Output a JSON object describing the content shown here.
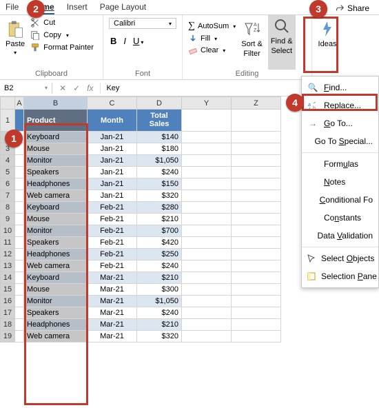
{
  "tabs": {
    "file": "File",
    "home": "Home",
    "insert": "Insert",
    "page_layout": "Page Layout"
  },
  "share": "Share",
  "clipboard": {
    "paste": "Paste",
    "cut": "Cut",
    "copy": "Copy",
    "format_painter": "Format Painter",
    "label": "Clipboard"
  },
  "font": {
    "name": "Calibri",
    "bold": "B",
    "italic": "I",
    "underline": "U",
    "label": "Font"
  },
  "editing": {
    "autosum": "AutoSum",
    "fill": "Fill",
    "clear": "Clear",
    "sort": "Sort &",
    "filter": "Filter",
    "find": "Find &",
    "select": "Select",
    "label": "Editing"
  },
  "ideas": "Ideas",
  "namebox": "B2",
  "fx": "fx",
  "formula_value": "Key",
  "col_headers": [
    "A",
    "B",
    "C",
    "D",
    "Y",
    "Z"
  ],
  "table": {
    "headers": {
      "product": "Product",
      "month": "Month",
      "sales": "Total Sales"
    },
    "rows": [
      {
        "n": 2,
        "p": "Keyboard",
        "m": "Jan-21",
        "s": "$140"
      },
      {
        "n": 3,
        "p": "Mouse",
        "m": "Jan-21",
        "s": "$180"
      },
      {
        "n": 4,
        "p": "Monitor",
        "m": "Jan-21",
        "s": "$1,050"
      },
      {
        "n": 5,
        "p": "Speakers",
        "m": "Jan-21",
        "s": "$240"
      },
      {
        "n": 6,
        "p": "Headphones",
        "m": "Jan-21",
        "s": "$150"
      },
      {
        "n": 7,
        "p": "Web camera",
        "m": "Jan-21",
        "s": "$320"
      },
      {
        "n": 8,
        "p": "Keyboard",
        "m": "Feb-21",
        "s": "$280"
      },
      {
        "n": 9,
        "p": "Mouse",
        "m": "Feb-21",
        "s": "$210"
      },
      {
        "n": 10,
        "p": "Monitor",
        "m": "Feb-21",
        "s": "$700"
      },
      {
        "n": 11,
        "p": "Speakers",
        "m": "Feb-21",
        "s": "$420"
      },
      {
        "n": 12,
        "p": "Headphones",
        "m": "Feb-21",
        "s": "$250"
      },
      {
        "n": 13,
        "p": "Web camera",
        "m": "Feb-21",
        "s": "$240"
      },
      {
        "n": 14,
        "p": "Keyboard",
        "m": "Mar-21",
        "s": "$210"
      },
      {
        "n": 15,
        "p": "Mouse",
        "m": "Mar-21",
        "s": "$300"
      },
      {
        "n": 16,
        "p": "Monitor",
        "m": "Mar-21",
        "s": "$1,050"
      },
      {
        "n": 17,
        "p": "Speakers",
        "m": "Mar-21",
        "s": "$240"
      },
      {
        "n": 18,
        "p": "Headphones",
        "m": "Mar-21",
        "s": "$210"
      },
      {
        "n": 19,
        "p": "Web camera",
        "m": "Mar-21",
        "s": "$320"
      }
    ]
  },
  "menu": {
    "find": "Find...",
    "replace": "Replace...",
    "goto": "Go To...",
    "gotospecial": "Go To Special...",
    "formulas": "Formulas",
    "notes": "Notes",
    "cond": "Conditional Fo",
    "constants": "Constants",
    "datav": "Data Validation",
    "selobj": "Select Objects",
    "selpane": "Selection Pane"
  },
  "callouts": {
    "c1": "1",
    "c2": "2",
    "c3": "3",
    "c4": "4"
  },
  "colors": {
    "accent": "#4f81bd",
    "callout": "#c0392b"
  }
}
